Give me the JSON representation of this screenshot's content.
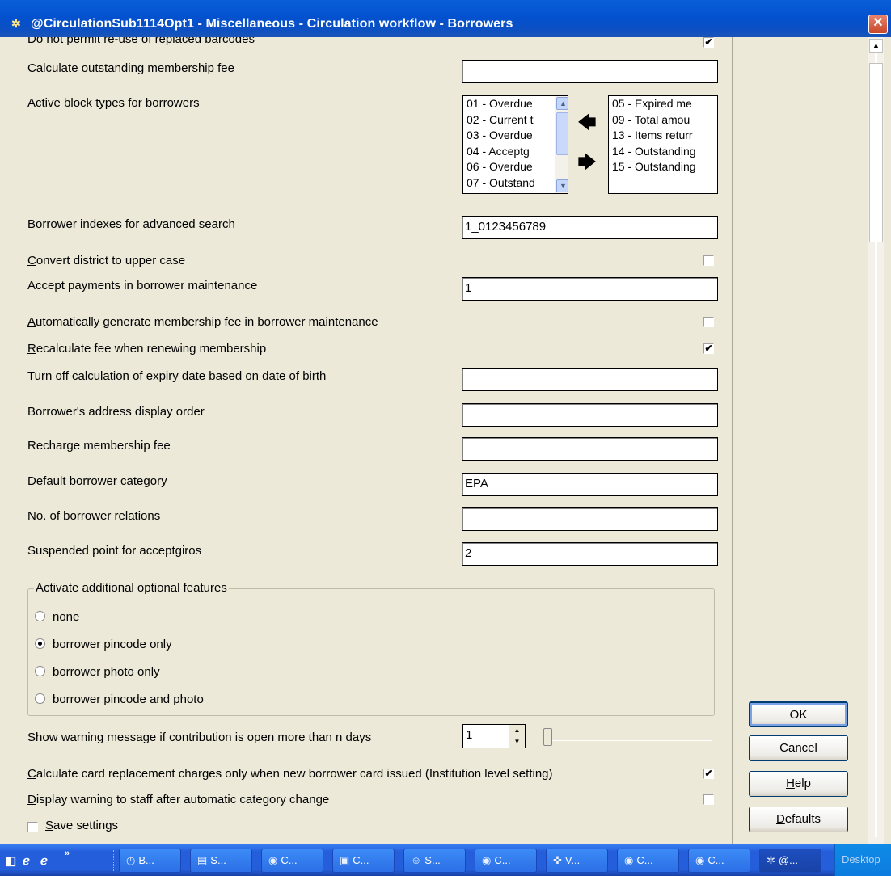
{
  "window": {
    "title": "@CirculationSub1114Opt1 - Miscellaneous - Circulation workflow - Borrowers",
    "app_icon": "settings-gear-icon",
    "close_glyph": "✕"
  },
  "form": {
    "cut_row_label": "Do not permit re-use of replaced barcodes",
    "cut_row_checked": true,
    "outstanding_fee": {
      "label": "Calculate outstanding membership fee",
      "value": ""
    },
    "block_types": {
      "label": "Active block types for borrowers",
      "available": [
        "01 - Overdue",
        "02 - Current t",
        "03 - Overdue",
        "04 - Acceptg",
        "06 - Overdue",
        "07 - Outstand"
      ],
      "selected": [
        "05 - Expired me",
        "09 - Total amou",
        "13 - Items returr",
        "14 - Outstanding",
        "15 - Outstanding"
      ],
      "move_left_glyph": "🡄",
      "move_right_glyph": "🡆"
    },
    "adv_search": {
      "label": "Borrower indexes for advanced search",
      "value": "1_0123456789"
    },
    "convert_district": {
      "label_accel": "C",
      "label_rest": "onvert district to upper case",
      "checked": false
    },
    "accept_payments": {
      "label": "Accept payments in borrower maintenance",
      "value": "1"
    },
    "auto_fee": {
      "label_accel": "A",
      "label_rest": "utomatically generate membership fee in borrower maintenance",
      "checked": false
    },
    "recalc_fee": {
      "label_accel": "R",
      "label_rest": "ecalculate fee when renewing membership",
      "checked": true
    },
    "expiry_dob": {
      "label": "Turn off calculation of expiry date based on date of birth",
      "value": ""
    },
    "address_order": {
      "label": "Borrower's address display order",
      "value": ""
    },
    "recharge_fee": {
      "label": "Recharge membership fee",
      "value": ""
    },
    "default_category": {
      "label": "Default borrower category",
      "value": "EPA"
    },
    "relations": {
      "label": "No. of borrower relations",
      "value": ""
    },
    "suspended_point": {
      "label": "Suspended point for acceptgiros",
      "value": "2"
    },
    "optional_features": {
      "legend": "Activate additional optional features",
      "options": [
        "none",
        "borrower pincode only",
        "borrower photo only",
        "borrower pincode and photo"
      ],
      "selected_index": 1
    },
    "warning_days": {
      "label": "Show warning message if contribution is open more than n days",
      "value": "1",
      "slider_level": 0.0
    },
    "card_replacement": {
      "label_accel": "C",
      "label_rest": "alculate card replacement charges only when new borrower card issued  (Institution level setting)",
      "checked": true
    },
    "category_change": {
      "label_accel": "D",
      "label_rest": "isplay warning to staff after automatic category change",
      "checked": false
    },
    "save_settings": {
      "label_accel": "S",
      "label_rest": "ave settings",
      "checked": false
    }
  },
  "buttons": {
    "ok": "OK",
    "cancel": "Cancel",
    "help_accel": "H",
    "help_rest": "elp",
    "defaults_accel": "D",
    "defaults_rest": "efaults"
  },
  "taskbar": {
    "buttons": [
      {
        "icon": "clock-icon",
        "glyph": "◷",
        "label": "B..."
      },
      {
        "icon": "word-doc-icon",
        "glyph": "▤",
        "label": "S..."
      },
      {
        "icon": "globe-app-icon",
        "glyph": "◉",
        "label": "C..."
      },
      {
        "icon": "computer-icon",
        "glyph": "▣",
        "label": "C..."
      },
      {
        "icon": "user-icon",
        "glyph": "☺",
        "label": "S..."
      },
      {
        "icon": "globe-app-icon",
        "glyph": "◉",
        "label": "C..."
      },
      {
        "icon": "vdx-icon",
        "glyph": "✜",
        "label": "V..."
      },
      {
        "icon": "globe-app-icon",
        "glyph": "◉",
        "label": "C..."
      },
      {
        "icon": "globe-app-icon",
        "glyph": "◉",
        "label": "C..."
      },
      {
        "icon": "settings-gear-icon",
        "glyph": "✲",
        "label": "@..."
      }
    ],
    "tray_label": "Desktop"
  }
}
